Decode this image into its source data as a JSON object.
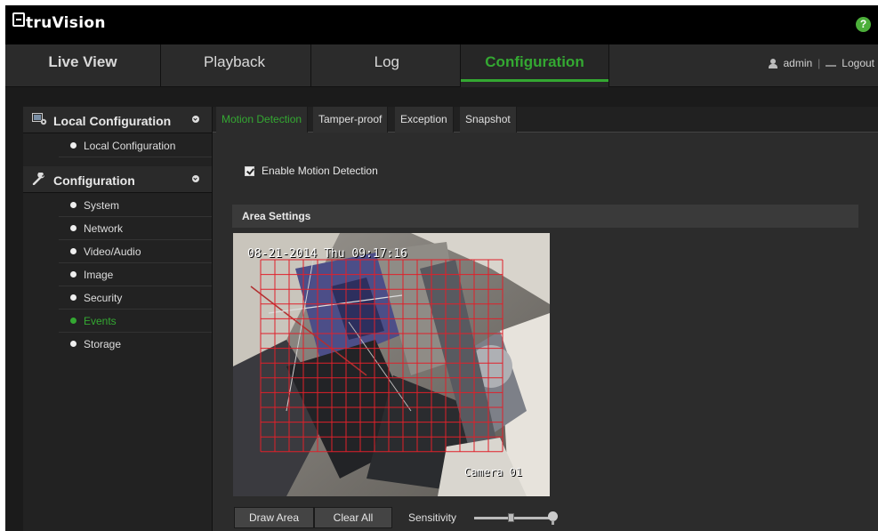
{
  "brand": {
    "name": "truVision"
  },
  "help_icon_text": "?",
  "nav": {
    "tabs": [
      {
        "label": "Live View"
      },
      {
        "label": "Playback"
      },
      {
        "label": "Log"
      },
      {
        "label": "Configuration",
        "active": true
      }
    ],
    "user": "admin",
    "separator": "|",
    "logout": "Logout"
  },
  "sidebar": {
    "groups": [
      {
        "label": "Local Configuration",
        "icon": "local-config-icon",
        "items": [
          {
            "label": "Local Configuration"
          }
        ]
      },
      {
        "label": "Configuration",
        "icon": "wrench-icon",
        "items": [
          {
            "label": "System"
          },
          {
            "label": "Network"
          },
          {
            "label": "Video/Audio"
          },
          {
            "label": "Image"
          },
          {
            "label": "Security"
          },
          {
            "label": "Events",
            "active": true
          },
          {
            "label": "Storage"
          }
        ]
      }
    ]
  },
  "subtabs": [
    {
      "label": "Motion Detection",
      "active": true
    },
    {
      "label": "Tamper-proof"
    },
    {
      "label": "Exception"
    },
    {
      "label": "Snapshot"
    }
  ],
  "motion": {
    "enable_label": "Enable Motion Detection",
    "enabled": true,
    "area_title": "Area Settings",
    "osd_datetime": "08-21-2014 Thu 09:17:16",
    "osd_camera": "Camera 01",
    "grid_color": "#e0202a",
    "buttons": {
      "draw": "Draw Area",
      "clear": "Clear All"
    },
    "sensitivity_label": "Sensitivity",
    "sensitivity_level": 0.45
  },
  "colors": {
    "accent": "#34a832",
    "background": "#2c2c2c",
    "topbar": "#000000"
  }
}
